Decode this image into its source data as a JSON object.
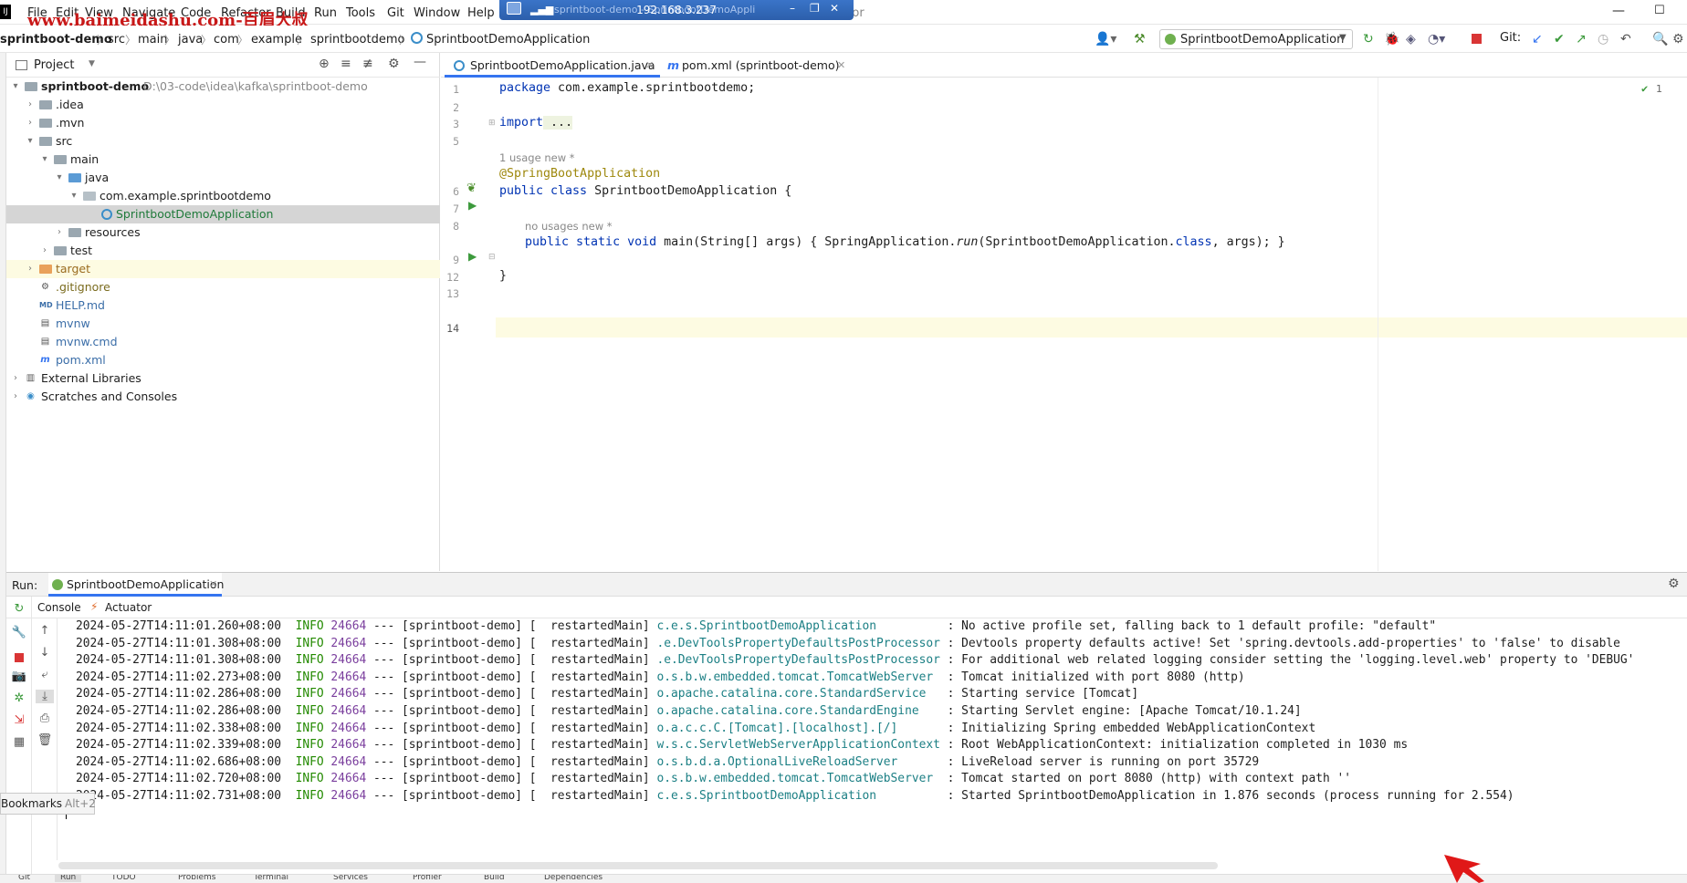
{
  "menubar": {
    "watermark": "www.baimeidashu.com-百眉大叔",
    "items": [
      "File",
      "Edit",
      "View",
      "Navigate",
      "Code",
      "Refactor",
      "Build",
      "Run",
      "Tools",
      "Git",
      "Window",
      "Help"
    ],
    "remote_host": "192.168.3.237",
    "remote_title_behind": "sprintboot-demo - SprintbootDemoApplication.java - Administrator"
  },
  "navbar": {
    "project": "sprintboot-demo",
    "crumbs": [
      "src",
      "main",
      "java",
      "com",
      "example",
      "sprintbootdemo",
      "SprintbootDemoApplication"
    ],
    "run_config": "SprintbootDemoApplication",
    "git_label": "Git:"
  },
  "project_panel": {
    "title": "Project",
    "tree": [
      {
        "label": "sprintboot-demo",
        "path": "D:\\03-code\\idea\\kafka\\sprintboot-demo"
      },
      {
        "label": ".idea"
      },
      {
        "label": ".mvn"
      },
      {
        "label": "src"
      },
      {
        "label": "main"
      },
      {
        "label": "java"
      },
      {
        "label": "com.example.sprintbootdemo"
      },
      {
        "label": "SprintbootDemoApplication"
      },
      {
        "label": "resources"
      },
      {
        "label": "test"
      },
      {
        "label": "target"
      },
      {
        "label": ".gitignore"
      },
      {
        "label": "HELP.md"
      },
      {
        "label": "mvnw"
      },
      {
        "label": "mvnw.cmd"
      },
      {
        "label": "pom.xml"
      },
      {
        "label": "External Libraries"
      },
      {
        "label": "Scratches and Consoles"
      }
    ]
  },
  "editor": {
    "tabs": [
      "SprintbootDemoApplication.java",
      "pom.xml (sprintboot-demo)"
    ],
    "line_numbers": [
      "1",
      "2",
      "3",
      "5",
      "6",
      "7",
      "8",
      "9",
      "12",
      "13",
      "14"
    ],
    "code": {
      "l1_kw": "package",
      "l1_rest": " com.example.sprintbootdemo;",
      "l3_kw": "import",
      "l3_rest": " ...",
      "hint1": "1 usage   new *",
      "l6": "@SpringBootApplication",
      "l7_kw": "public class",
      "l7_rest": " SprintbootDemoApplication {",
      "hint2": "no usages   new *",
      "l9_kw": "public static void",
      "l9_a": " main(String[] args) { SpringApplication.",
      "l9_run": "run",
      "l9_b": "(SprintbootDemoApplication.",
      "l9_class": "class",
      "l9_c": ", args); }",
      "l13": "}"
    },
    "inspection": "1"
  },
  "run_panel": {
    "label": "Run:",
    "tab": "SprintbootDemoApplication",
    "subtabs": [
      "Console",
      "Actuator"
    ],
    "logs": [
      {
        "ts": "2024-05-27T14:11:01.260+08:00",
        "level": "INFO",
        "pid": "24664",
        "mid": " --- [sprintboot-demo] [  restartedMain] ",
        "cls": "c.e.s.SprintbootDemoApplication         ",
        "msg": " : No active profile set, falling back to 1 default profile: \"default\""
      },
      {
        "ts": "2024-05-27T14:11:01.308+08:00",
        "level": "INFO",
        "pid": "24664",
        "mid": " --- [sprintboot-demo] [  restartedMain] ",
        "cls": ".e.DevToolsPropertyDefaultsPostProcessor",
        "msg": " : Devtools property defaults active! Set 'spring.devtools.add-properties' to 'false' to disable"
      },
      {
        "ts": "2024-05-27T14:11:01.308+08:00",
        "level": "INFO",
        "pid": "24664",
        "mid": " --- [sprintboot-demo] [  restartedMain] ",
        "cls": ".e.DevToolsPropertyDefaultsPostProcessor",
        "msg": " : For additional web related logging consider setting the 'logging.level.web' property to 'DEBUG'"
      },
      {
        "ts": "2024-05-27T14:11:02.273+08:00",
        "level": "INFO",
        "pid": "24664",
        "mid": " --- [sprintboot-demo] [  restartedMain] ",
        "cls": "o.s.b.w.embedded.tomcat.TomcatWebServer ",
        "msg": " : Tomcat initialized with port 8080 (http)"
      },
      {
        "ts": "2024-05-27T14:11:02.286+08:00",
        "level": "INFO",
        "pid": "24664",
        "mid": " --- [sprintboot-demo] [  restartedMain] ",
        "cls": "o.apache.catalina.core.StandardService  ",
        "msg": " : Starting service [Tomcat]"
      },
      {
        "ts": "2024-05-27T14:11:02.286+08:00",
        "level": "INFO",
        "pid": "24664",
        "mid": " --- [sprintboot-demo] [  restartedMain] ",
        "cls": "o.apache.catalina.core.StandardEngine   ",
        "msg": " : Starting Servlet engine: [Apache Tomcat/10.1.24]"
      },
      {
        "ts": "2024-05-27T14:11:02.338+08:00",
        "level": "INFO",
        "pid": "24664",
        "mid": " --- [sprintboot-demo] [  restartedMain] ",
        "cls": "o.a.c.c.C.[Tomcat].[localhost].[/]      ",
        "msg": " : Initializing Spring embedded WebApplicationContext"
      },
      {
        "ts": "2024-05-27T14:11:02.339+08:00",
        "level": "INFO",
        "pid": "24664",
        "mid": " --- [sprintboot-demo] [  restartedMain] ",
        "cls": "w.s.c.ServletWebServerApplicationContext",
        "msg": " : Root WebApplicationContext: initialization completed in 1030 ms"
      },
      {
        "ts": "2024-05-27T14:11:02.686+08:00",
        "level": "INFO",
        "pid": "24664",
        "mid": " --- [sprintboot-demo] [  restartedMain] ",
        "cls": "o.s.b.d.a.OptionalLiveReloadServer      ",
        "msg": " : LiveReload server is running on port 35729"
      },
      {
        "ts": "2024-05-27T14:11:02.720+08:00",
        "level": "INFO",
        "pid": "24664",
        "mid": " --- [sprintboot-demo] [  restartedMain] ",
        "cls": "o.s.b.w.embedded.tomcat.TomcatWebServer ",
        "msg": " : Tomcat started on port 8080 (http) with context path ''"
      },
      {
        "ts": "2024-05-27T14:11:02.731+08:00",
        "level": "INFO",
        "pid": "24664",
        "mid": " --- [sprintboot-demo] [  restartedMain] ",
        "cls": "c.e.s.SprintbootDemoApplication         ",
        "msg": " : Started SprintbootDemoApplication in 1.876 seconds (process running for 2.554)"
      }
    ]
  },
  "bookmarks": {
    "label": "Bookmarks",
    "shortcut": "Alt+2"
  },
  "bottom_tools": [
    "Git",
    "Run",
    "TODO",
    "Problems",
    "Terminal",
    "Services",
    "Profiler",
    "Build",
    "Dependencies"
  ],
  "colors": {
    "accent": "#3574f0",
    "keyword": "#0033b3",
    "annotation": "#9e880d",
    "info": "#238a00",
    "class_name": "#1b7f84",
    "watermark": "#c81818"
  }
}
